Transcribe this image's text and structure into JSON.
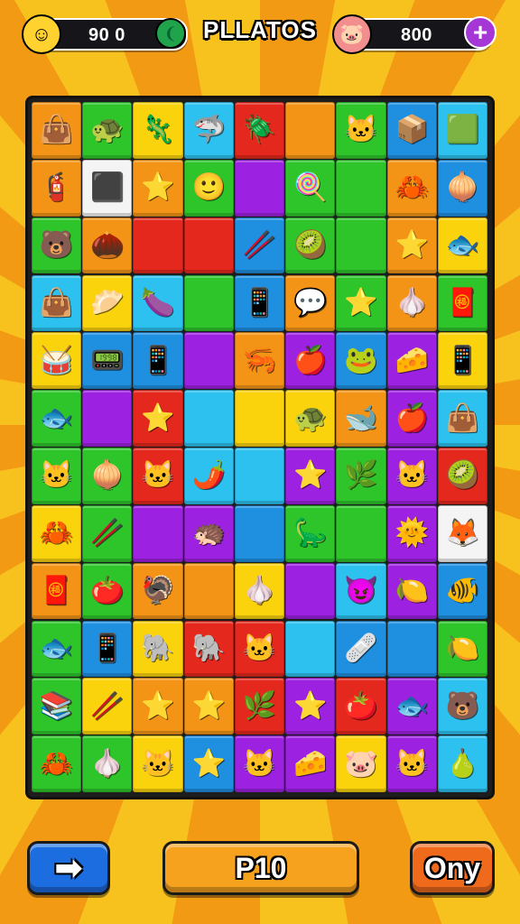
{
  "hud": {
    "left_value": "90 0",
    "right_value": "800",
    "title": "PLLATOS",
    "left_avatar_icon": "smiley-face-icon",
    "right_avatar_icon": "pig-face-icon",
    "add_icon": "plus-icon",
    "left_badge_icon": "leaf-icon"
  },
  "colors": {
    "orange": "#f39417",
    "yellow": "#fbd30d",
    "green": "#2ec52b",
    "blue": "#1f8fe0",
    "cyan": "#2cc1ee",
    "red": "#e5281d",
    "purple": "#9d21e0",
    "white": "#f4f4f4",
    "dark_blue": "#1b63d8"
  },
  "board": {
    "rows": [
      [
        {
          "c": "orange",
          "g": "👜",
          "n": "bag-icon"
        },
        {
          "c": "green",
          "g": "🐢",
          "n": "turtle-icon"
        },
        {
          "c": "yellow",
          "g": "🦎",
          "n": "lizard-icon"
        },
        {
          "c": "cyan",
          "g": "🦈",
          "n": "shark-icon"
        },
        {
          "c": "red",
          "g": "🪲",
          "n": "beetle-icon"
        },
        {
          "c": "orange",
          "g": "",
          "n": "empty-tile"
        },
        {
          "c": "green",
          "g": "🐱",
          "n": "cat-face-icon"
        },
        {
          "c": "blue",
          "g": "📦",
          "n": "box-icon"
        },
        {
          "c": "cyan",
          "g": "🟩",
          "n": "square-icon"
        }
      ],
      [
        {
          "c": "orange",
          "g": "🧯",
          "n": "eraser-icon"
        },
        {
          "c": "white",
          "g": "⬛",
          "n": "cube-icon"
        },
        {
          "c": "orange",
          "g": "⭐",
          "n": "star-icon"
        },
        {
          "c": "green",
          "g": "🙂",
          "n": "smiley-icon"
        },
        {
          "c": "purple",
          "g": "",
          "n": "empty-tile"
        },
        {
          "c": "green",
          "g": "🍭",
          "n": "lollipop-icon"
        },
        {
          "c": "green",
          "g": "",
          "n": "empty-tile"
        },
        {
          "c": "orange",
          "g": "🦀",
          "n": "sun-crab-icon"
        },
        {
          "c": "blue",
          "g": "🧅",
          "n": "onion-icon"
        }
      ],
      [
        {
          "c": "green",
          "g": "🐻",
          "n": "bear-face-icon"
        },
        {
          "c": "orange",
          "g": "🌰",
          "n": "spiky-icon"
        },
        {
          "c": "red",
          "g": "",
          "n": "empty-tile"
        },
        {
          "c": "red",
          "g": "",
          "n": "empty-tile"
        },
        {
          "c": "blue",
          "g": "🥢",
          "n": "crossed-sticks-icon"
        },
        {
          "c": "green",
          "g": "🥝",
          "n": "melon-icon"
        },
        {
          "c": "green",
          "g": "",
          "n": "empty-tile"
        },
        {
          "c": "orange",
          "g": "⭐",
          "n": "star-icon"
        },
        {
          "c": "yellow",
          "g": "🐟",
          "n": "fish-icon"
        }
      ],
      [
        {
          "c": "cyan",
          "g": "👜",
          "n": "bag-icon"
        },
        {
          "c": "yellow",
          "g": "🥟",
          "n": "dumpling-icon"
        },
        {
          "c": "cyan",
          "g": "🍆",
          "n": "eggplant-icon"
        },
        {
          "c": "green",
          "g": "",
          "n": "empty-tile"
        },
        {
          "c": "blue",
          "g": "📱",
          "n": "phone-icon"
        },
        {
          "c": "orange",
          "g": "💬",
          "n": "bubble-icon"
        },
        {
          "c": "green",
          "g": "⭐",
          "n": "star-icon"
        },
        {
          "c": "orange",
          "g": "🧄",
          "n": "garlic-icon"
        },
        {
          "c": "green",
          "g": "🧧",
          "n": "sign-icon"
        }
      ],
      [
        {
          "c": "yellow",
          "g": "🥁",
          "n": "drum-icon"
        },
        {
          "c": "blue",
          "g": "📟",
          "n": "pager-icon"
        },
        {
          "c": "blue",
          "g": "📱",
          "n": "phone-icon"
        },
        {
          "c": "purple",
          "g": "",
          "n": "empty-tile"
        },
        {
          "c": "orange",
          "g": "🦐",
          "n": "shrimp-icon"
        },
        {
          "c": "purple",
          "g": "🍎",
          "n": "apple-icon"
        },
        {
          "c": "blue",
          "g": "🐸",
          "n": "frog-icon"
        },
        {
          "c": "purple",
          "g": "🧀",
          "n": "cheese-icon"
        },
        {
          "c": "yellow",
          "g": "📱",
          "n": "tablet-icon"
        }
      ],
      [
        {
          "c": "green",
          "g": "🐟",
          "n": "fish-icon"
        },
        {
          "c": "purple",
          "g": "",
          "n": "empty-tile"
        },
        {
          "c": "red",
          "g": "⭐",
          "n": "star-icon"
        },
        {
          "c": "cyan",
          "g": "",
          "n": "empty-tile"
        },
        {
          "c": "yellow",
          "g": "",
          "n": "empty-tile"
        },
        {
          "c": "yellow",
          "g": "🐢",
          "n": "turtle-icon"
        },
        {
          "c": "orange",
          "g": "🐋",
          "n": "whale-icon"
        },
        {
          "c": "purple",
          "g": "🍎",
          "n": "apple-icon"
        },
        {
          "c": "cyan",
          "g": "👜",
          "n": "bag-icon"
        }
      ],
      [
        {
          "c": "green",
          "g": "🐱",
          "n": "cat-face-icon"
        },
        {
          "c": "green",
          "g": "🧅",
          "n": "onion-icon"
        },
        {
          "c": "red",
          "g": "🐱",
          "n": "cat-face-icon"
        },
        {
          "c": "cyan",
          "g": "🌶️",
          "n": "pepper-icon"
        },
        {
          "c": "cyan",
          "g": "",
          "n": "empty-tile"
        },
        {
          "c": "purple",
          "g": "⭐",
          "n": "star-icon"
        },
        {
          "c": "green",
          "g": "🌿",
          "n": "sprout-icon"
        },
        {
          "c": "purple",
          "g": "🐱",
          "n": "cat-face-icon"
        },
        {
          "c": "red",
          "g": "🥝",
          "n": "melon-icon"
        }
      ],
      [
        {
          "c": "yellow",
          "g": "🦀",
          "n": "crab-icon"
        },
        {
          "c": "green",
          "g": "🥢",
          "n": "crossed-sticks-icon"
        },
        {
          "c": "purple",
          "g": "",
          "n": "empty-tile"
        },
        {
          "c": "purple",
          "g": "🦔",
          "n": "urchin-icon"
        },
        {
          "c": "blue",
          "g": "",
          "n": "empty-tile"
        },
        {
          "c": "green",
          "g": "🦕",
          "n": "dino-icon"
        },
        {
          "c": "green",
          "g": "",
          "n": "empty-tile"
        },
        {
          "c": "purple",
          "g": "🌞",
          "n": "sun-icon"
        },
        {
          "c": "white",
          "g": "🦊",
          "n": "fox-icon"
        }
      ],
      [
        {
          "c": "orange",
          "g": "🧧",
          "n": "sign-icon"
        },
        {
          "c": "green",
          "g": "🍅",
          "n": "tomato-icon"
        },
        {
          "c": "orange",
          "g": "🦃",
          "n": "bird-icon"
        },
        {
          "c": "orange",
          "g": "",
          "n": "empty-tile"
        },
        {
          "c": "yellow",
          "g": "🧄",
          "n": "garlic-icon"
        },
        {
          "c": "purple",
          "g": "",
          "n": "empty-tile"
        },
        {
          "c": "cyan",
          "g": "😈",
          "n": "devil-icon"
        },
        {
          "c": "purple",
          "g": "🍋",
          "n": "lemon-icon"
        },
        {
          "c": "blue",
          "g": "🐠",
          "n": "fish-icon"
        }
      ],
      [
        {
          "c": "green",
          "g": "🐟",
          "n": "fish-icon"
        },
        {
          "c": "blue",
          "g": "📱",
          "n": "phone-icon"
        },
        {
          "c": "yellow",
          "g": "🐘",
          "n": "elephant-icon"
        },
        {
          "c": "red",
          "g": "🐘",
          "n": "elephant-icon"
        },
        {
          "c": "red",
          "g": "🐱",
          "n": "cat-face-icon"
        },
        {
          "c": "cyan",
          "g": "",
          "n": "empty-tile"
        },
        {
          "c": "blue",
          "g": "🩹",
          "n": "bandage-icon"
        },
        {
          "c": "blue",
          "g": "",
          "n": "empty-tile"
        },
        {
          "c": "green",
          "g": "🍋",
          "n": "lemon-icon"
        }
      ],
      [
        {
          "c": "green",
          "g": "📚",
          "n": "papers-icon"
        },
        {
          "c": "yellow",
          "g": "🥢",
          "n": "crossed-sticks-icon"
        },
        {
          "c": "orange",
          "g": "⭐",
          "n": "star-icon"
        },
        {
          "c": "orange",
          "g": "⭐",
          "n": "star-icon"
        },
        {
          "c": "red",
          "g": "🌿",
          "n": "sprout-icon"
        },
        {
          "c": "purple",
          "g": "⭐",
          "n": "star-icon"
        },
        {
          "c": "red",
          "g": "🍅",
          "n": "tomato-icon"
        },
        {
          "c": "purple",
          "g": "🐟",
          "n": "fish-icon"
        },
        {
          "c": "cyan",
          "g": "🐻",
          "n": "bear-face-icon"
        }
      ],
      [
        {
          "c": "green",
          "g": "🦀",
          "n": "crab-icon"
        },
        {
          "c": "green",
          "g": "🧄",
          "n": "garlic-icon"
        },
        {
          "c": "yellow",
          "g": "🐱",
          "n": "cat-face-icon"
        },
        {
          "c": "blue",
          "g": "⭐",
          "n": "star-icon"
        },
        {
          "c": "purple",
          "g": "🐱",
          "n": "cat-face-icon"
        },
        {
          "c": "purple",
          "g": "🧀",
          "n": "cheese-icon"
        },
        {
          "c": "yellow",
          "g": "🐷",
          "n": "pig-face-icon"
        },
        {
          "c": "purple",
          "g": "🐱",
          "n": "cat-face-icon"
        },
        {
          "c": "cyan",
          "g": "🍐",
          "n": "pear-icon"
        }
      ]
    ]
  },
  "buttons": {
    "next_icon": "arrow-right-icon",
    "next_glyph": "➡",
    "center_label": "P10",
    "right_label": "Ony"
  }
}
